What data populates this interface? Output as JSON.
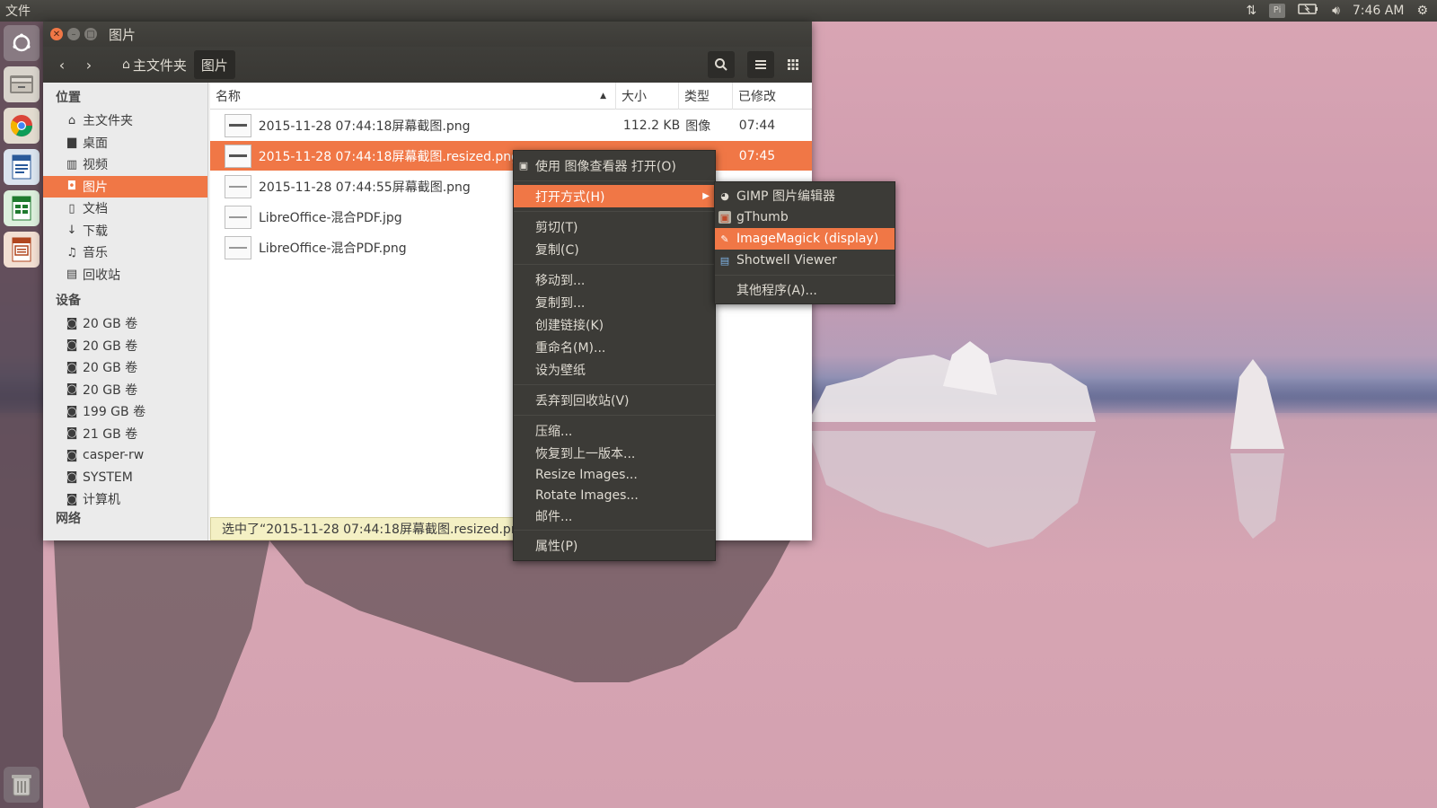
{
  "top_panel": {
    "app_menu": "文件",
    "clock": "7:46 AM",
    "keyboard": "Pi"
  },
  "window": {
    "title": "图片",
    "breadcrumbs": [
      "主文件夹",
      "图片"
    ]
  },
  "sidebar": {
    "places_heading": "位置",
    "places": [
      "主文件夹",
      "桌面",
      "视频",
      "图片",
      "文档",
      "下载",
      "音乐",
      "回收站"
    ],
    "devices_heading": "设备",
    "devices": [
      "20 GB 卷",
      "20 GB 卷",
      "20 GB 卷",
      "20 GB 卷",
      "199 GB 卷",
      "21 GB 卷",
      "casper-rw",
      "SYSTEM",
      "计算机"
    ],
    "network_heading": "网络"
  },
  "filelist": {
    "columns": {
      "name": "名称",
      "size": "大小",
      "type": "类型",
      "modified": "已修改"
    },
    "rows": [
      {
        "name": "2015-11-28 07:44:18屏幕截图.png",
        "size": "112.2 KB",
        "type": "图像",
        "modified": "07:44"
      },
      {
        "name": "2015-11-28 07:44:18屏幕截图.resized.png",
        "size": "",
        "type": "像",
        "modified": "07:45"
      },
      {
        "name": "2015-11-28 07:44:55屏幕截图.png",
        "size": "",
        "type": "",
        "modified": ""
      },
      {
        "name": "LibreOffice-混合PDF.jpg",
        "size": "",
        "type": "",
        "modified": ""
      },
      {
        "name": "LibreOffice-混合PDF.png",
        "size": "",
        "type": "",
        "modified": ""
      }
    ],
    "status": "选中了“2015-11-28 07:44:18屏幕截图.resized.png"
  },
  "context_menu": {
    "open_with_viewer": "使用 图像查看器 打开(O)",
    "open_with": "打开方式(H)",
    "cut": "剪切(T)",
    "copy": "复制(C)",
    "move_to": "移动到...",
    "copy_to": "复制到...",
    "make_link": "创建链接(K)",
    "rename": "重命名(M)...",
    "set_wallpaper": "设为壁纸",
    "trash": "丢弃到回收站(V)",
    "compress": "压缩...",
    "revert": "恢复到上一版本...",
    "resize_images": "Resize Images...",
    "rotate_images": "Rotate Images...",
    "email": "邮件...",
    "properties": "属性(P)"
  },
  "submenu": {
    "gimp": "GIMP 图片编辑器",
    "gthumb": "gThumb",
    "imagemagick": "ImageMagick (display)",
    "shotwell": "Shotwell Viewer",
    "other": "其他程序(A)..."
  },
  "colors": {
    "accent": "#f07746",
    "panel": "#3c3b37",
    "menu_text": "#dfdbd2"
  }
}
